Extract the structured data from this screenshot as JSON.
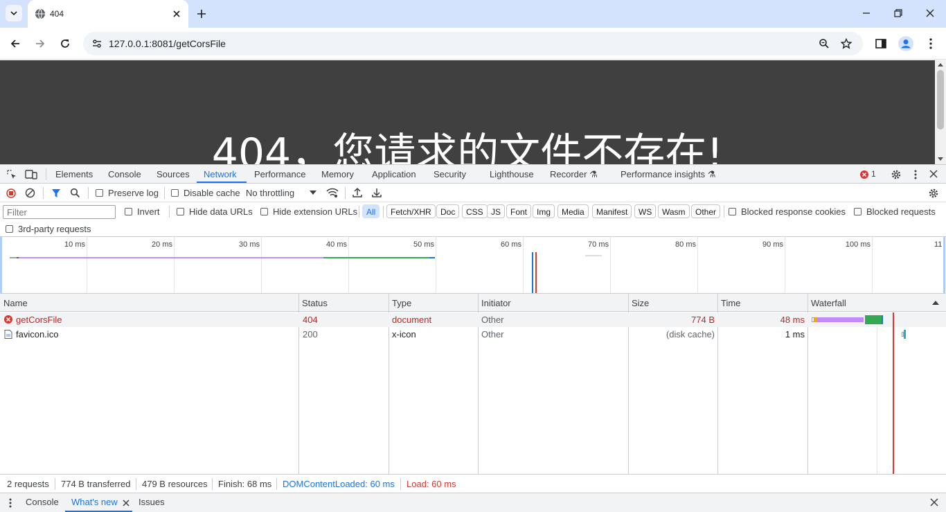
{
  "browser": {
    "tab_title": "404",
    "url": "127.0.0.1:8081/getCorsFile"
  },
  "page": {
    "headline": "404，您请求的文件不存在!"
  },
  "devtools": {
    "tabs": [
      "Elements",
      "Console",
      "Sources",
      "Network",
      "Performance",
      "Memory",
      "Application",
      "Security",
      "Lighthouse",
      "Recorder",
      "Performance insights"
    ],
    "active_tab": "Network",
    "error_count": "1",
    "network_toolbar": {
      "preserve_log": "Preserve log",
      "disable_cache": "Disable cache",
      "throttling": "No throttling"
    },
    "filter": {
      "placeholder": "Filter",
      "invert": "Invert",
      "hide_data_urls": "Hide data URLs",
      "hide_extension_urls": "Hide extension URLs",
      "types": [
        "All",
        "Fetch/XHR",
        "Doc",
        "CSS",
        "JS",
        "Font",
        "Img",
        "Media",
        "Manifest",
        "WS",
        "Wasm",
        "Other"
      ],
      "selected_type": "All",
      "blocked_response_cookies": "Blocked response cookies",
      "blocked_requests": "Blocked requests",
      "third_party": "3rd-party requests"
    },
    "overview_ticks": [
      "10 ms",
      "20 ms",
      "30 ms",
      "40 ms",
      "50 ms",
      "60 ms",
      "70 ms",
      "80 ms",
      "90 ms",
      "100 ms",
      "11"
    ],
    "columns": {
      "name": "Name",
      "status": "Status",
      "type": "Type",
      "initiator": "Initiator",
      "size": "Size",
      "time": "Time",
      "waterfall": "Waterfall"
    },
    "requests": [
      {
        "name": "getCorsFile",
        "status": "404",
        "type": "document",
        "initiator": "Other",
        "size": "774 B",
        "time": "48 ms",
        "failed": true
      },
      {
        "name": "favicon.ico",
        "status": "200",
        "type": "x-icon",
        "initiator": "Other",
        "size": "(disk cache)",
        "time": "1 ms",
        "failed": false
      }
    ],
    "summary": {
      "requests": "2 requests",
      "transferred": "774 B transferred",
      "resources": "479 B resources",
      "finish": "Finish: 68 ms",
      "dom_content_loaded": "DOMContentLoaded: 60 ms",
      "load": "Load: 60 ms"
    },
    "drawer_tabs": [
      "Console",
      "What's new",
      "Issues"
    ],
    "drawer_active": "What's new"
  },
  "colors": {
    "accent": "#1a73e8",
    "error": "#c5221f",
    "waiting": "#c58af9",
    "download": "#34a853",
    "page_bg": "#404040"
  }
}
